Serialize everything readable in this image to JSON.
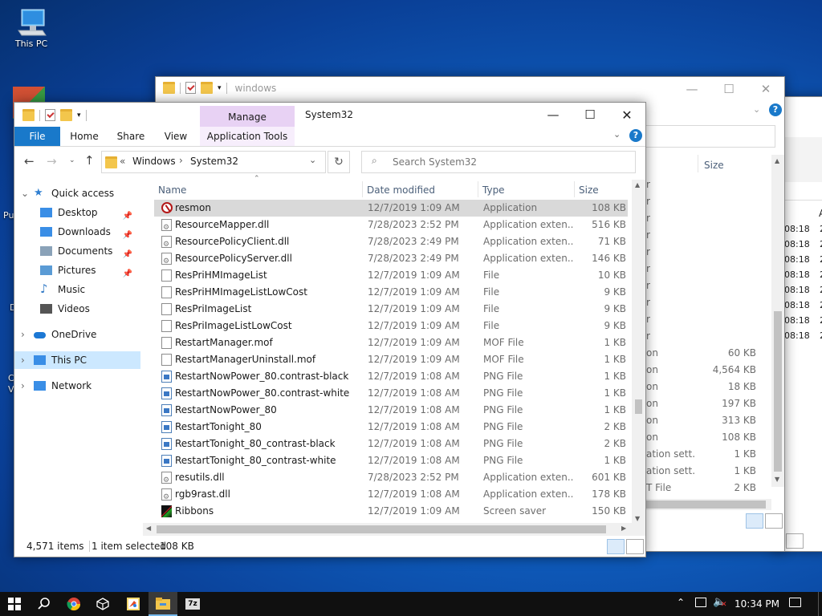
{
  "desktop": {
    "icons": [
      {
        "label": "This PC",
        "icon": "this-pc-icon"
      }
    ],
    "fragments": [
      "Pu",
      "D",
      "C",
      "V"
    ]
  },
  "back_window": {
    "title": "windows",
    "size_header": "Size",
    "partial_types": [
      "r",
      "r",
      "r",
      "r",
      "r",
      "r",
      "r",
      "r",
      "r",
      "r",
      "on",
      "on",
      "on",
      "on",
      "on",
      "on",
      "ation sett...",
      "ation sett...",
      "T File"
    ],
    "sizes": [
      "",
      "",
      "",
      "",
      "",
      "",
      "",
      "",
      "",
      "",
      "60 KB",
      "4,564 KB",
      "18 KB",
      "197 KB",
      "313 KB",
      "108 KB",
      "1 KB",
      "1 KB",
      "2 KB"
    ]
  },
  "far_window": {
    "times": [
      "08:18",
      "08:18",
      "08:18",
      "08:18",
      "08:18",
      "08:18",
      "08:18",
      "08:18"
    ],
    "col2": [
      "A",
      "2",
      "2",
      "2",
      "2",
      "2",
      "2",
      "2",
      "2"
    ]
  },
  "front_window": {
    "title": "System32",
    "ribbon": {
      "manage_label": "Manage",
      "tabs": [
        "File",
        "Home",
        "Share",
        "View"
      ],
      "app_tools_label": "Application Tools"
    },
    "address": {
      "prefix": "«",
      "crumbs": [
        "Windows",
        "System32"
      ]
    },
    "search": {
      "placeholder": "Search System32"
    },
    "nav": [
      {
        "label": "Quick access",
        "icon": "star-icon",
        "pinned": false
      },
      {
        "label": "Desktop",
        "icon": "desktop-folder-icon",
        "pinned": true
      },
      {
        "label": "Downloads",
        "icon": "downloads-folder-icon",
        "pinned": true
      },
      {
        "label": "Documents",
        "icon": "documents-folder-icon",
        "pinned": true
      },
      {
        "label": "Pictures",
        "icon": "pictures-folder-icon",
        "pinned": true
      },
      {
        "label": "Music",
        "icon": "music-folder-icon",
        "pinned": false
      },
      {
        "label": "Videos",
        "icon": "videos-folder-icon",
        "pinned": false
      },
      {
        "label": "OneDrive",
        "icon": "onedrive-icon",
        "pinned": false
      },
      {
        "label": "This PC",
        "icon": "this-pc-icon",
        "pinned": false
      },
      {
        "label": "Network",
        "icon": "network-icon",
        "pinned": false
      }
    ],
    "columns": [
      "Name",
      "Date modified",
      "Type",
      "Size"
    ],
    "files": [
      {
        "name": "resmon",
        "date": "12/7/2019 1:09 AM",
        "type": "Application",
        "size": "108 KB",
        "icon": "resmon"
      },
      {
        "name": "ResourceMapper.dll",
        "date": "7/28/2023 2:52 PM",
        "type": "Application exten...",
        "size": "516 KB",
        "icon": "dll"
      },
      {
        "name": "ResourcePolicyClient.dll",
        "date": "7/28/2023 2:49 PM",
        "type": "Application exten...",
        "size": "71 KB",
        "icon": "dll"
      },
      {
        "name": "ResourcePolicyServer.dll",
        "date": "7/28/2023 2:49 PM",
        "type": "Application exten...",
        "size": "146 KB",
        "icon": "dll"
      },
      {
        "name": "ResPriHMImageList",
        "date": "12/7/2019 1:09 AM",
        "type": "File",
        "size": "10 KB",
        "icon": "file"
      },
      {
        "name": "ResPriHMImageListLowCost",
        "date": "12/7/2019 1:09 AM",
        "type": "File",
        "size": "9 KB",
        "icon": "file"
      },
      {
        "name": "ResPriImageList",
        "date": "12/7/2019 1:09 AM",
        "type": "File",
        "size": "9 KB",
        "icon": "file"
      },
      {
        "name": "ResPriImageListLowCost",
        "date": "12/7/2019 1:09 AM",
        "type": "File",
        "size": "9 KB",
        "icon": "file"
      },
      {
        "name": "RestartManager.mof",
        "date": "12/7/2019 1:09 AM",
        "type": "MOF File",
        "size": "1 KB",
        "icon": "file"
      },
      {
        "name": "RestartManagerUninstall.mof",
        "date": "12/7/2019 1:09 AM",
        "type": "MOF File",
        "size": "1 KB",
        "icon": "file"
      },
      {
        "name": "RestartNowPower_80.contrast-black",
        "date": "12/7/2019 1:08 AM",
        "type": "PNG File",
        "size": "1 KB",
        "icon": "png"
      },
      {
        "name": "RestartNowPower_80.contrast-white",
        "date": "12/7/2019 1:08 AM",
        "type": "PNG File",
        "size": "1 KB",
        "icon": "png"
      },
      {
        "name": "RestartNowPower_80",
        "date": "12/7/2019 1:08 AM",
        "type": "PNG File",
        "size": "1 KB",
        "icon": "png"
      },
      {
        "name": "RestartTonight_80",
        "date": "12/7/2019 1:08 AM",
        "type": "PNG File",
        "size": "2 KB",
        "icon": "png"
      },
      {
        "name": "RestartTonight_80_contrast-black",
        "date": "12/7/2019 1:08 AM",
        "type": "PNG File",
        "size": "2 KB",
        "icon": "png"
      },
      {
        "name": "RestartTonight_80_contrast-white",
        "date": "12/7/2019 1:08 AM",
        "type": "PNG File",
        "size": "1 KB",
        "icon": "png"
      },
      {
        "name": "resutils.dll",
        "date": "7/28/2023 2:52 PM",
        "type": "Application exten...",
        "size": "601 KB",
        "icon": "dll"
      },
      {
        "name": "rgb9rast.dll",
        "date": "12/7/2019 1:08 AM",
        "type": "Application exten...",
        "size": "178 KB",
        "icon": "dll"
      },
      {
        "name": "Ribbons",
        "date": "12/7/2019 1:09 AM",
        "type": "Screen saver",
        "size": "150 KB",
        "icon": "ribbons"
      }
    ],
    "status": {
      "items": "4,571 items",
      "selected": "1 item selected",
      "selected_size": "108 KB"
    }
  },
  "taskbar": {
    "apps": [
      "start-icon",
      "search-icon",
      "chrome-icon",
      "virtualbox-icon",
      "paint-icon",
      "file-explorer-icon",
      "7zip-icon"
    ],
    "time": "10:34 PM"
  },
  "colors": {
    "selection": "#cce8ff",
    "selected_row": "#d9d9d9",
    "file_tab": "#1979ca",
    "manage_tab": "#e8d2f4",
    "taskbar": "#101010"
  }
}
